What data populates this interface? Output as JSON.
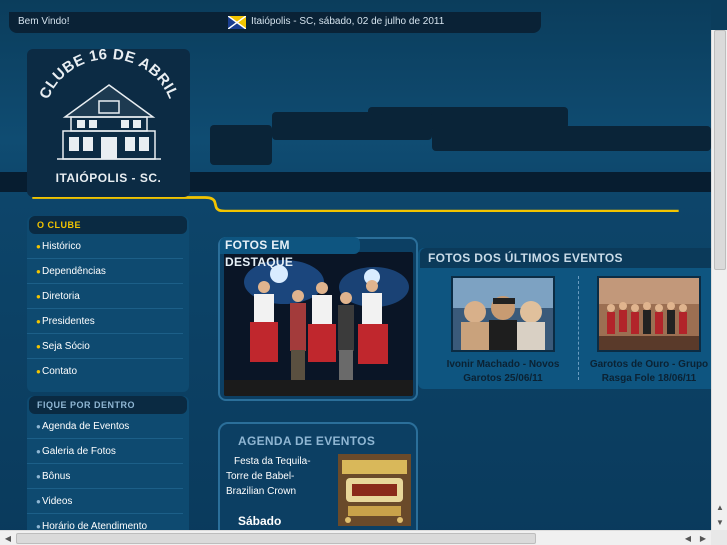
{
  "topbar": {
    "welcome": "Bem Vindo!",
    "date_text": "Itaiópolis - SC, sábado, 02 de julho de 2011"
  },
  "logo": {
    "name": "CLUBE 16 DE ABRIL",
    "city": "ITAIÓPOLIS - SC."
  },
  "sidebar": {
    "clube": {
      "title": "O CLUBE",
      "items": [
        {
          "label": "Histórico"
        },
        {
          "label": "Dependências"
        },
        {
          "label": "Diretoria"
        },
        {
          "label": "Presidentes"
        },
        {
          "label": "Seja Sócio"
        },
        {
          "label": "Contato"
        }
      ]
    },
    "fique": {
      "title": "FIQUE POR DENTRO",
      "items": [
        {
          "label": "Agenda de Eventos"
        },
        {
          "label": "Galeria de Fotos"
        },
        {
          "label": "Bônus"
        },
        {
          "label": "Videos"
        },
        {
          "label": "Horário de Atendimento"
        }
      ]
    }
  },
  "destaque": {
    "title": "FOTOS EM DESTAQUE"
  },
  "ultimos": {
    "title": "FOTOS DOS ÚLTIMOS EVENTOS",
    "events": [
      {
        "caption_line1": "Ivonir Machado - Novos",
        "caption_line2": "Garotos 25/06/11"
      },
      {
        "caption_line1": "Garotos de Ouro - Grupo",
        "caption_line2": "Rasga Fole 18/06/11"
      }
    ]
  },
  "agenda": {
    "title": "AGENDA DE EVENTOS",
    "event": "Festa da Tequila- Torre de Babel- Brazilian Crown",
    "day": "Sábado"
  },
  "colors": {
    "accent_yellow": "#f2c400",
    "bg_blue": "#0f4c72",
    "dark_navy": "#0a2236"
  }
}
